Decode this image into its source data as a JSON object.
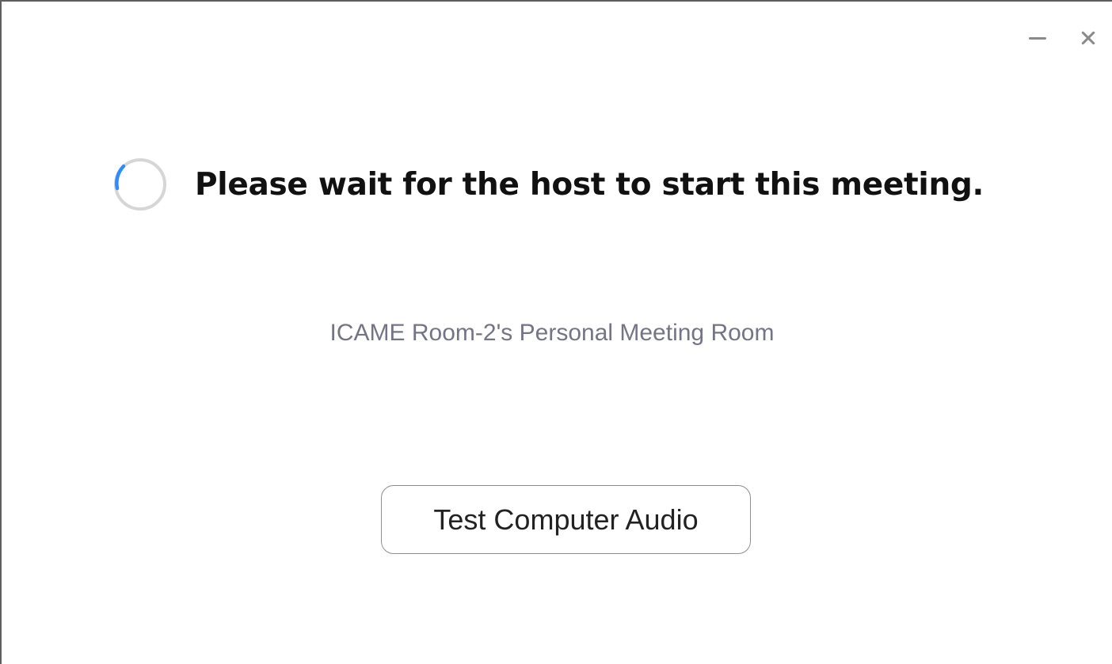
{
  "window": {
    "controls": {
      "minimize_icon": "minimize-icon",
      "close_icon": "close-icon"
    }
  },
  "status": {
    "spinner_icon": "loading-spinner-icon",
    "message": "Please wait for the host to start this meeting."
  },
  "meeting": {
    "room_name": "ICAME Room-2's Personal Meeting Room"
  },
  "actions": {
    "test_audio_label": "Test Computer Audio"
  },
  "colors": {
    "spinner_track": "#d6d6d6",
    "spinner_accent": "#2d8cff",
    "message_text": "#111111",
    "room_text": "#747487",
    "button_border": "#8d8d94"
  }
}
